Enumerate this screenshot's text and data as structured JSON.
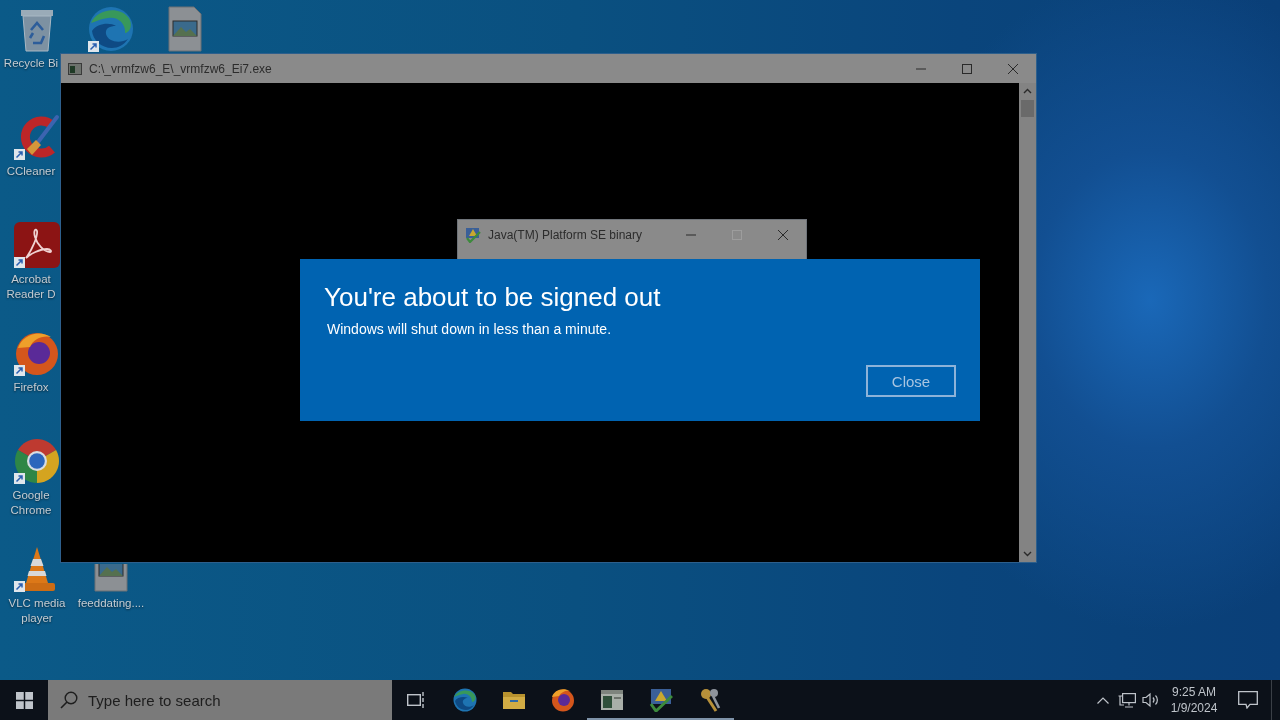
{
  "desktop": {
    "icons": [
      {
        "kind": "recycle-bin",
        "label": "Recycle Bi",
        "shortcut": false
      },
      {
        "kind": "edge",
        "shortcut": true
      },
      {
        "kind": "image-file",
        "shortcut": false
      },
      {
        "kind": "ccleaner",
        "label": "CCleaner",
        "shortcut": true
      },
      {
        "kind": "acrobat",
        "label": "Acrobat Reader D",
        "shortcut": true
      },
      {
        "kind": "firefox",
        "label": "Firefox",
        "shortcut": true
      },
      {
        "kind": "chrome",
        "label": "Google Chrome",
        "shortcut": true
      },
      {
        "kind": "vlc",
        "label": "VLC media player",
        "shortcut": true
      },
      {
        "kind": "image-file",
        "label": "feeddating....",
        "shortcut": false
      }
    ]
  },
  "windows": [
    {
      "kind": "console",
      "title": "C:\\_vrmfzw6_E\\_vrmfzw6_Ei7.exe",
      "buttons": [
        {
          "kind": "minimize",
          "disabled": false
        },
        {
          "kind": "maximize",
          "disabled": false
        },
        {
          "kind": "close",
          "disabled": false
        }
      ]
    },
    {
      "kind": "java",
      "title": "Java(TM) Platform SE binary",
      "buttons": [
        {
          "kind": "minimize",
          "disabled": false
        },
        {
          "kind": "maximize",
          "disabled": true
        },
        {
          "kind": "close",
          "disabled": false
        }
      ]
    }
  ],
  "dialog": {
    "title": "You're about to be signed out",
    "message": "Windows will shut down in less than a minute.",
    "button": "Close"
  },
  "taskbar": {
    "search": {
      "placeholder": "Type here to search"
    },
    "apps": [
      {
        "kind": "edge",
        "running": false
      },
      {
        "kind": "explorer",
        "running": false
      },
      {
        "kind": "firefox",
        "running": false
      },
      {
        "kind": "console",
        "running": true
      },
      {
        "kind": "java",
        "running": true
      },
      {
        "kind": "keys",
        "running": true
      }
    ],
    "clock": {
      "time": "9:25 AM",
      "date": "1/9/2024"
    }
  }
}
